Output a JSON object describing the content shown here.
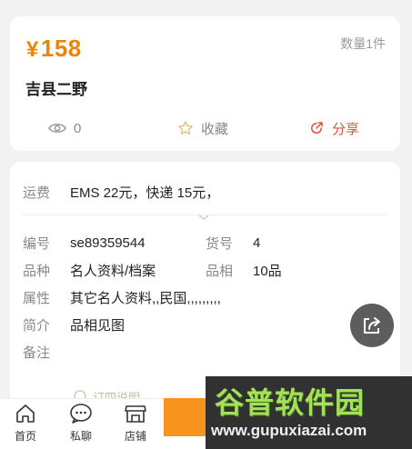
{
  "listing": {
    "currency": "¥",
    "price": "158",
    "quantity": "数量1件",
    "title": "吉县二野",
    "views": "0",
    "favorite_label": "收藏",
    "share_label": "分享"
  },
  "details": {
    "shipping_label": "运费",
    "shipping_value": "EMS 22元，快递 15元，",
    "code_label": "编号",
    "code_value": "se89359544",
    "item_no_label": "货号",
    "item_no_value": "4",
    "category_label": "品种",
    "category_value": "名人资料/档案",
    "condition_label": "品相",
    "condition_value": "10品",
    "attr_label": "属性",
    "attr_value": "其它名人资料,,民国,,,,,,,,,",
    "intro_label": "简介",
    "intro_value": "品相见图",
    "note_label": "备注",
    "partial_text": "订四说明"
  },
  "tabbar": {
    "home": "首页",
    "chat": "私聊",
    "shop": "店铺"
  },
  "watermark": {
    "title": "谷普软件园",
    "url": "www.gupuxiazai.com"
  },
  "colors": {
    "price": "#e8860c",
    "share": "#d9533c",
    "buy_button": "#f7941d"
  }
}
